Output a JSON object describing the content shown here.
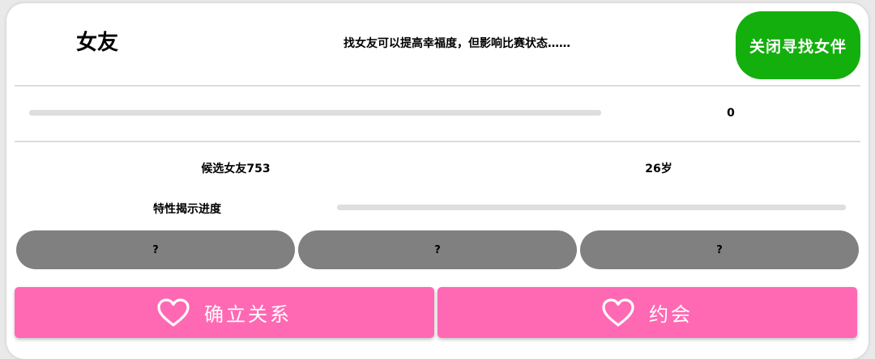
{
  "header": {
    "title": "女友",
    "description": "找女友可以提高幸福度，但影响比赛状态……",
    "close_button_label": "关闭寻找女伴"
  },
  "progress": {
    "value_label": "0",
    "value": 0
  },
  "candidate": {
    "name": "候选女友753",
    "age": "26岁"
  },
  "traits": {
    "label": "特性揭示进度",
    "reveal_progress": 0,
    "slots": [
      "?",
      "?",
      "?"
    ]
  },
  "actions": {
    "confirm_label": "确立关系",
    "date_label": "约会"
  },
  "colors": {
    "accent_green": "#13af0d",
    "accent_pink": "#ff69b4",
    "slot_gray": "#808080"
  },
  "icons": {
    "confirm": "heart-icon",
    "date": "heart-icon"
  }
}
